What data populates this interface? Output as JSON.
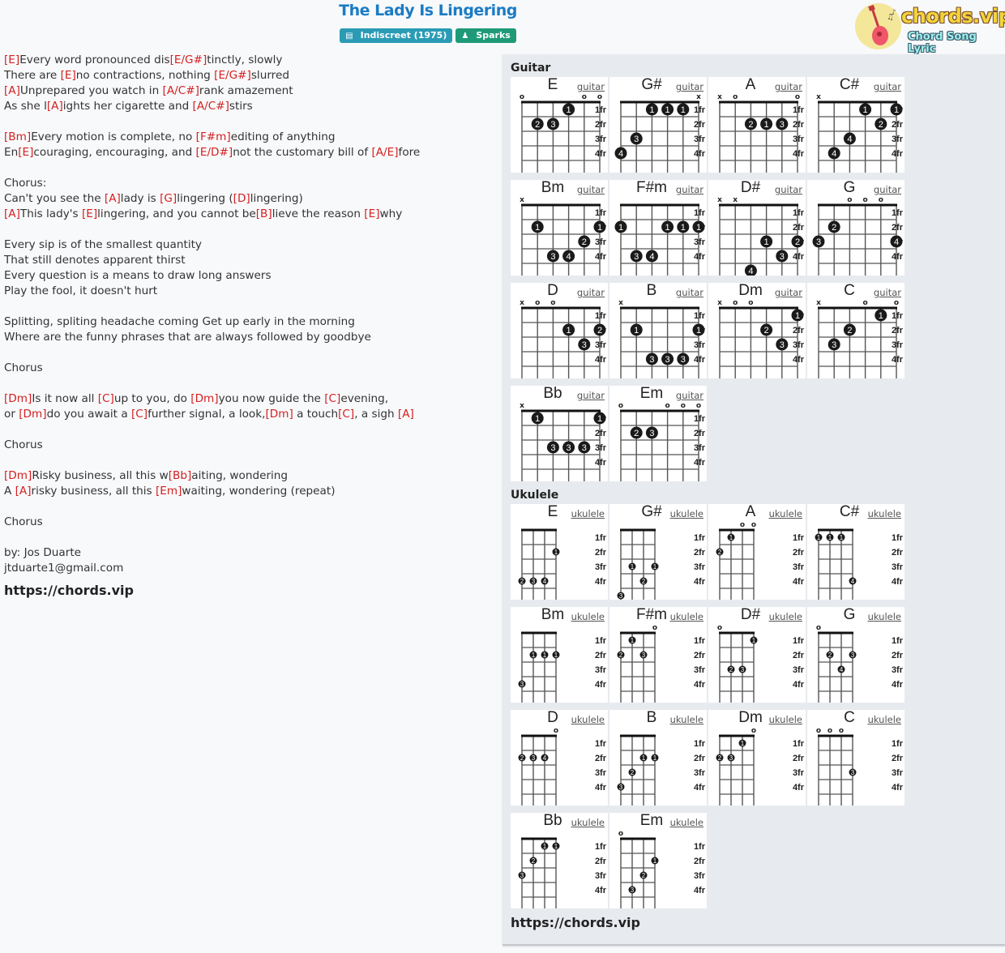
{
  "song": {
    "title": "The Lady Is Lingering",
    "album_badge": "Indiscreet (1975)",
    "artist_badge": "Sparks",
    "album_icon": "book-icon",
    "artist_icon": "user-icon"
  },
  "logo": {
    "main": "chords.vip",
    "sub": "Chord Song Lyric",
    "icon": "guitar-icon"
  },
  "lyrics": [
    [
      [
        "c",
        "E"
      ],
      [
        "t",
        "Every word pronounced dis"
      ],
      [
        "c",
        "E/G#"
      ],
      [
        "t",
        "tinctly, slowly"
      ]
    ],
    [
      [
        "t",
        "There are "
      ],
      [
        "c",
        "E"
      ],
      [
        "t",
        "no contractions, nothing "
      ],
      [
        "c",
        "E/G#"
      ],
      [
        "t",
        "slurred"
      ]
    ],
    [
      [
        "c",
        "A"
      ],
      [
        "t",
        "Unprepared you watch in "
      ],
      [
        "c",
        "A/C#"
      ],
      [
        "t",
        "rank amazement"
      ]
    ],
    [
      [
        "t",
        "As she l"
      ],
      [
        "c",
        "A"
      ],
      [
        "t",
        "ights her cigarette and "
      ],
      [
        "c",
        "A/C#"
      ],
      [
        "t",
        "stirs"
      ]
    ],
    [],
    [
      [
        "c",
        "Bm"
      ],
      [
        "t",
        "Every motion is complete, no "
      ],
      [
        "c",
        "F#m"
      ],
      [
        "t",
        "editing of anything"
      ]
    ],
    [
      [
        "t",
        "En"
      ],
      [
        "c",
        "E"
      ],
      [
        "t",
        "couraging, encouraging, and "
      ],
      [
        "c",
        "E/D#"
      ],
      [
        "t",
        "not the customary bill of "
      ],
      [
        "c",
        "A/E"
      ],
      [
        "t",
        "fore"
      ]
    ],
    [],
    [
      [
        "t",
        "Chorus:"
      ]
    ],
    [
      [
        "t",
        "Can't you see the "
      ],
      [
        "c",
        "A"
      ],
      [
        "t",
        "lady is "
      ],
      [
        "c",
        "G"
      ],
      [
        "t",
        "lingering ("
      ],
      [
        "c",
        "D"
      ],
      [
        "t",
        "lingering)"
      ]
    ],
    [
      [
        "c",
        "A"
      ],
      [
        "t",
        "This lady's "
      ],
      [
        "c",
        "E"
      ],
      [
        "t",
        "lingering, and you cannot be"
      ],
      [
        "c",
        "B"
      ],
      [
        "t",
        "lieve the reason "
      ],
      [
        "c",
        "E"
      ],
      [
        "t",
        "why"
      ]
    ],
    [],
    [
      [
        "t",
        "Every sip is of the smallest quantity"
      ]
    ],
    [
      [
        "t",
        "That still denotes apparent thirst"
      ]
    ],
    [
      [
        "t",
        "Every question is a means to draw long answers"
      ]
    ],
    [
      [
        "t",
        "Play the fool, it doesn't hurt"
      ]
    ],
    [],
    [
      [
        "t",
        "Splitting, spliting headache coming Get up early in the morning"
      ]
    ],
    [
      [
        "t",
        "Where are the funny phrases that are always followed by goodbye"
      ]
    ],
    [],
    [
      [
        "t",
        "Chorus"
      ]
    ],
    [],
    [
      [
        "c",
        "Dm"
      ],
      [
        "t",
        "Is it now all "
      ],
      [
        "c",
        "C"
      ],
      [
        "t",
        "up to you, do "
      ],
      [
        "c",
        "Dm"
      ],
      [
        "t",
        "you now guide the "
      ],
      [
        "c",
        "C"
      ],
      [
        "t",
        "evening,"
      ]
    ],
    [
      [
        "t",
        "or "
      ],
      [
        "c",
        "Dm"
      ],
      [
        "t",
        "do you await a "
      ],
      [
        "c",
        "C"
      ],
      [
        "t",
        "further signal, a look,"
      ],
      [
        "c",
        "Dm"
      ],
      [
        "t",
        " a touch"
      ],
      [
        "c",
        "C"
      ],
      [
        "t",
        ", a sigh "
      ],
      [
        "c",
        "A"
      ]
    ],
    [],
    [
      [
        "t",
        "Chorus"
      ]
    ],
    [],
    [
      [
        "c",
        "Dm"
      ],
      [
        "t",
        "Risky business, all this w"
      ],
      [
        "c",
        "Bb"
      ],
      [
        "t",
        "aiting, wondering"
      ]
    ],
    [
      [
        "t",
        "A "
      ],
      [
        "c",
        "A"
      ],
      [
        "t",
        "risky business, all this "
      ],
      [
        "c",
        "Em"
      ],
      [
        "t",
        "waiting, wondering (repeat)"
      ]
    ],
    [],
    [
      [
        "t",
        "Chorus"
      ]
    ],
    [],
    [
      [
        "t",
        "by: Jos Duarte"
      ]
    ],
    [
      [
        "t",
        "jtduarte1@gmail.com"
      ]
    ]
  ],
  "lyrics_site": "https://chords.vip",
  "panel": {
    "guitar_label": "Guitar",
    "ukulele_label": "Ukulele",
    "bottom_site": "https://chords.vip",
    "fret_labels": [
      "1fr",
      "2fr",
      "3fr",
      "4fr"
    ],
    "guitar_type": "guitar",
    "ukulele_type": "ukulele"
  },
  "guitar_chords": [
    {
      "name": "E",
      "strings": [
        "o",
        "",
        "",
        "",
        "o",
        "o"
      ],
      "dots": [
        [
          4,
          1,
          "1"
        ],
        [
          2,
          2,
          "2"
        ],
        [
          3,
          2,
          "3"
        ]
      ]
    },
    {
      "name": "G#",
      "strings": [
        "",
        "",
        "",
        "",
        "",
        "x"
      ],
      "dots": [
        [
          3,
          1,
          "1"
        ],
        [
          4,
          1,
          "1"
        ],
        [
          5,
          1,
          "1"
        ],
        [
          2,
          3,
          "3"
        ],
        [
          1,
          4,
          "4"
        ]
      ]
    },
    {
      "name": "A",
      "strings": [
        "x",
        "o",
        "",
        "",
        "",
        "o"
      ],
      "dots": [
        [
          3,
          2,
          "2"
        ],
        [
          4,
          2,
          "1"
        ],
        [
          5,
          2,
          "3"
        ]
      ]
    },
    {
      "name": "C#",
      "strings": [
        "x",
        "",
        "",
        "",
        "",
        ""
      ],
      "dots": [
        [
          4,
          1,
          "1"
        ],
        [
          6,
          1,
          "1"
        ],
        [
          5,
          2,
          "2"
        ],
        [
          3,
          3,
          "4"
        ],
        [
          2,
          4,
          "4"
        ]
      ]
    },
    {
      "name": "Bm",
      "strings": [
        "x",
        "",
        "",
        "",
        "",
        ""
      ],
      "dots": [
        [
          2,
          2,
          "1"
        ],
        [
          6,
          2,
          "1"
        ],
        [
          5,
          3,
          "2"
        ],
        [
          3,
          4,
          "3"
        ],
        [
          4,
          4,
          "4"
        ]
      ]
    },
    {
      "name": "F#m",
      "strings": [
        "",
        "",
        "",
        "",
        "",
        ""
      ],
      "dots": [
        [
          1,
          2,
          "1"
        ],
        [
          4,
          2,
          "1"
        ],
        [
          5,
          2,
          "1"
        ],
        [
          6,
          2,
          "1"
        ],
        [
          2,
          4,
          "3"
        ],
        [
          3,
          4,
          "4"
        ]
      ]
    },
    {
      "name": "D#",
      "strings": [
        "x",
        "x",
        "",
        "",
        "",
        ""
      ],
      "dots": [
        [
          4,
          3,
          "1"
        ],
        [
          6,
          3,
          "2"
        ],
        [
          5,
          4,
          "3"
        ],
        [
          3,
          5,
          "4"
        ]
      ]
    },
    {
      "name": "G",
      "strings": [
        "",
        "",
        "o",
        "o",
        "o",
        ""
      ],
      "dots": [
        [
          2,
          2,
          "2"
        ],
        [
          1,
          3,
          "3"
        ],
        [
          6,
          3,
          "4"
        ]
      ]
    },
    {
      "name": "D",
      "strings": [
        "x",
        "o",
        "o",
        "",
        "",
        ""
      ],
      "dots": [
        [
          4,
          2,
          "1"
        ],
        [
          6,
          2,
          "2"
        ],
        [
          5,
          3,
          "3"
        ]
      ]
    },
    {
      "name": "B",
      "strings": [
        "x",
        "",
        "",
        "",
        "",
        ""
      ],
      "dots": [
        [
          2,
          2,
          "1"
        ],
        [
          6,
          2,
          "1"
        ],
        [
          3,
          4,
          "3"
        ],
        [
          4,
          4,
          "3"
        ],
        [
          5,
          4,
          "3"
        ]
      ]
    },
    {
      "name": "Dm",
      "strings": [
        "x",
        "o",
        "o",
        "",
        "",
        ""
      ],
      "dots": [
        [
          6,
          1,
          "1"
        ],
        [
          4,
          2,
          "2"
        ],
        [
          5,
          3,
          "3"
        ]
      ]
    },
    {
      "name": "C",
      "strings": [
        "x",
        "",
        "",
        "o",
        "",
        "o"
      ],
      "dots": [
        [
          5,
          1,
          "1"
        ],
        [
          3,
          2,
          "2"
        ],
        [
          2,
          3,
          "3"
        ]
      ]
    },
    {
      "name": "Bb",
      "strings": [
        "x",
        "",
        "",
        "",
        "",
        ""
      ],
      "dots": [
        [
          2,
          1,
          "1"
        ],
        [
          6,
          1,
          "1"
        ],
        [
          3,
          3,
          "3"
        ],
        [
          4,
          3,
          "3"
        ],
        [
          5,
          3,
          "3"
        ]
      ]
    },
    {
      "name": "Em",
      "strings": [
        "o",
        "",
        "",
        "o",
        "o",
        "o"
      ],
      "dots": [
        [
          2,
          2,
          "2"
        ],
        [
          3,
          2,
          "3"
        ]
      ]
    }
  ],
  "ukulele_chords": [
    {
      "name": "E",
      "strings": [
        "",
        "",
        "",
        ""
      ],
      "dots": [
        [
          4,
          2,
          "1"
        ],
        [
          1,
          4,
          "2"
        ],
        [
          2,
          4,
          "3"
        ],
        [
          3,
          4,
          "4"
        ]
      ]
    },
    {
      "name": "G#",
      "strings": [
        "",
        "",
        "",
        ""
      ],
      "dots": [
        [
          2,
          3,
          "1"
        ],
        [
          4,
          3,
          "1"
        ],
        [
          3,
          4,
          "2"
        ],
        [
          1,
          5,
          "3"
        ]
      ]
    },
    {
      "name": "A",
      "strings": [
        "",
        "",
        "o",
        "o"
      ],
      "dots": [
        [
          2,
          1,
          "1"
        ],
        [
          1,
          2,
          "2"
        ]
      ]
    },
    {
      "name": "C#",
      "strings": [
        "",
        "",
        "",
        ""
      ],
      "dots": [
        [
          1,
          1,
          "1"
        ],
        [
          2,
          1,
          "1"
        ],
        [
          3,
          1,
          "1"
        ],
        [
          4,
          4,
          "4"
        ]
      ]
    },
    {
      "name": "Bm",
      "strings": [
        "",
        "",
        "",
        ""
      ],
      "dots": [
        [
          2,
          2,
          "1"
        ],
        [
          3,
          2,
          "1"
        ],
        [
          4,
          2,
          "1"
        ],
        [
          1,
          4,
          "3"
        ]
      ]
    },
    {
      "name": "F#m",
      "strings": [
        "",
        "",
        "",
        "o"
      ],
      "dots": [
        [
          2,
          1,
          "1"
        ],
        [
          1,
          2,
          "2"
        ],
        [
          3,
          2,
          "3"
        ]
      ]
    },
    {
      "name": "D#",
      "strings": [
        "o",
        "",
        "",
        ""
      ],
      "dots": [
        [
          4,
          1,
          "1"
        ],
        [
          2,
          3,
          "2"
        ],
        [
          3,
          3,
          "3"
        ]
      ]
    },
    {
      "name": "G",
      "strings": [
        "o",
        "",
        "",
        ""
      ],
      "dots": [
        [
          2,
          2,
          "2"
        ],
        [
          4,
          2,
          "3"
        ],
        [
          3,
          3,
          "4"
        ]
      ]
    },
    {
      "name": "D",
      "strings": [
        "",
        "",
        "",
        "o"
      ],
      "dots": [
        [
          1,
          2,
          "2"
        ],
        [
          2,
          2,
          "3"
        ],
        [
          3,
          2,
          "4"
        ]
      ]
    },
    {
      "name": "B",
      "strings": [
        "",
        "",
        "",
        ""
      ],
      "dots": [
        [
          3,
          2,
          "1"
        ],
        [
          4,
          2,
          "1"
        ],
        [
          2,
          3,
          "2"
        ],
        [
          1,
          4,
          "3"
        ]
      ]
    },
    {
      "name": "Dm",
      "strings": [
        "",
        "",
        "",
        "o"
      ],
      "dots": [
        [
          3,
          1,
          "1"
        ],
        [
          1,
          2,
          "2"
        ],
        [
          2,
          2,
          "3"
        ]
      ]
    },
    {
      "name": "C",
      "strings": [
        "o",
        "o",
        "o",
        ""
      ],
      "dots": [
        [
          4,
          3,
          "3"
        ]
      ]
    },
    {
      "name": "Bb",
      "strings": [
        "",
        "",
        "",
        ""
      ],
      "dots": [
        [
          3,
          1,
          "1"
        ],
        [
          4,
          1,
          "1"
        ],
        [
          2,
          2,
          "2"
        ],
        [
          1,
          3,
          "3"
        ]
      ]
    },
    {
      "name": "Em",
      "strings": [
        "o",
        "",
        "",
        ""
      ],
      "dots": [
        [
          4,
          2,
          "1"
        ],
        [
          3,
          3,
          "2"
        ],
        [
          2,
          4,
          "3"
        ]
      ]
    }
  ],
  "colors": {
    "title": "#1b7cc4",
    "chord_text": "#d42020",
    "album_badge": "#2a9bb5",
    "artist_badge": "#1f9a79",
    "panel_bg": "#e7eaee"
  }
}
